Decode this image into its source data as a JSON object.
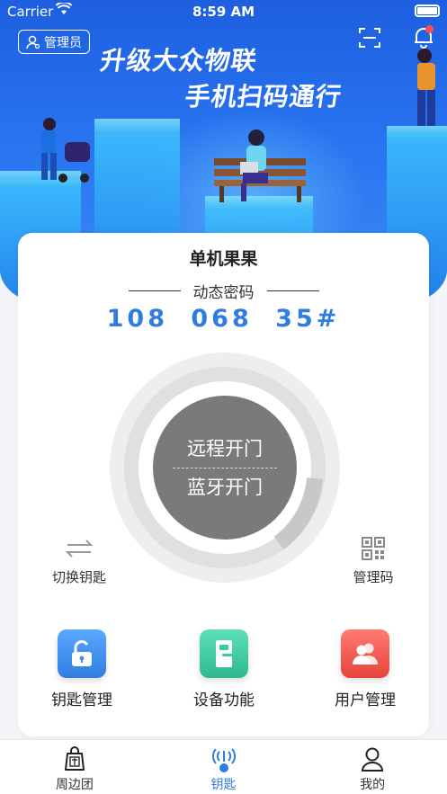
{
  "status": {
    "carrier": "Carrier",
    "time": "8:59 AM"
  },
  "header": {
    "admin_label": "管理员",
    "slogan_line1": "升级大众物联",
    "slogan_line2": "手机扫码通行"
  },
  "card": {
    "device_name": "单机果果",
    "dynamic_label": "动态密码",
    "dynamic_code": "108 068 35#",
    "dial": {
      "remote_open": "远程开门",
      "bluetooth_open": "蓝牙开门"
    },
    "switch_key": "切换钥匙",
    "manage_code": "管理码",
    "features": [
      {
        "label": "钥匙管理",
        "color": "#3d8cf5",
        "icon": "unlock-icon"
      },
      {
        "label": "设备功能",
        "color": "#3ccaa0",
        "icon": "door-icon"
      },
      {
        "label": "用户管理",
        "color": "#f0554e",
        "icon": "users-icon"
      }
    ]
  },
  "tabs": [
    {
      "label": "周边团",
      "icon": "bag-icon"
    },
    {
      "label": "钥匙",
      "icon": "key-signal-icon",
      "active": true
    },
    {
      "label": "我的",
      "icon": "person-icon"
    }
  ],
  "colors": {
    "primary": "#2f7de0",
    "hero": "#2873f0"
  }
}
